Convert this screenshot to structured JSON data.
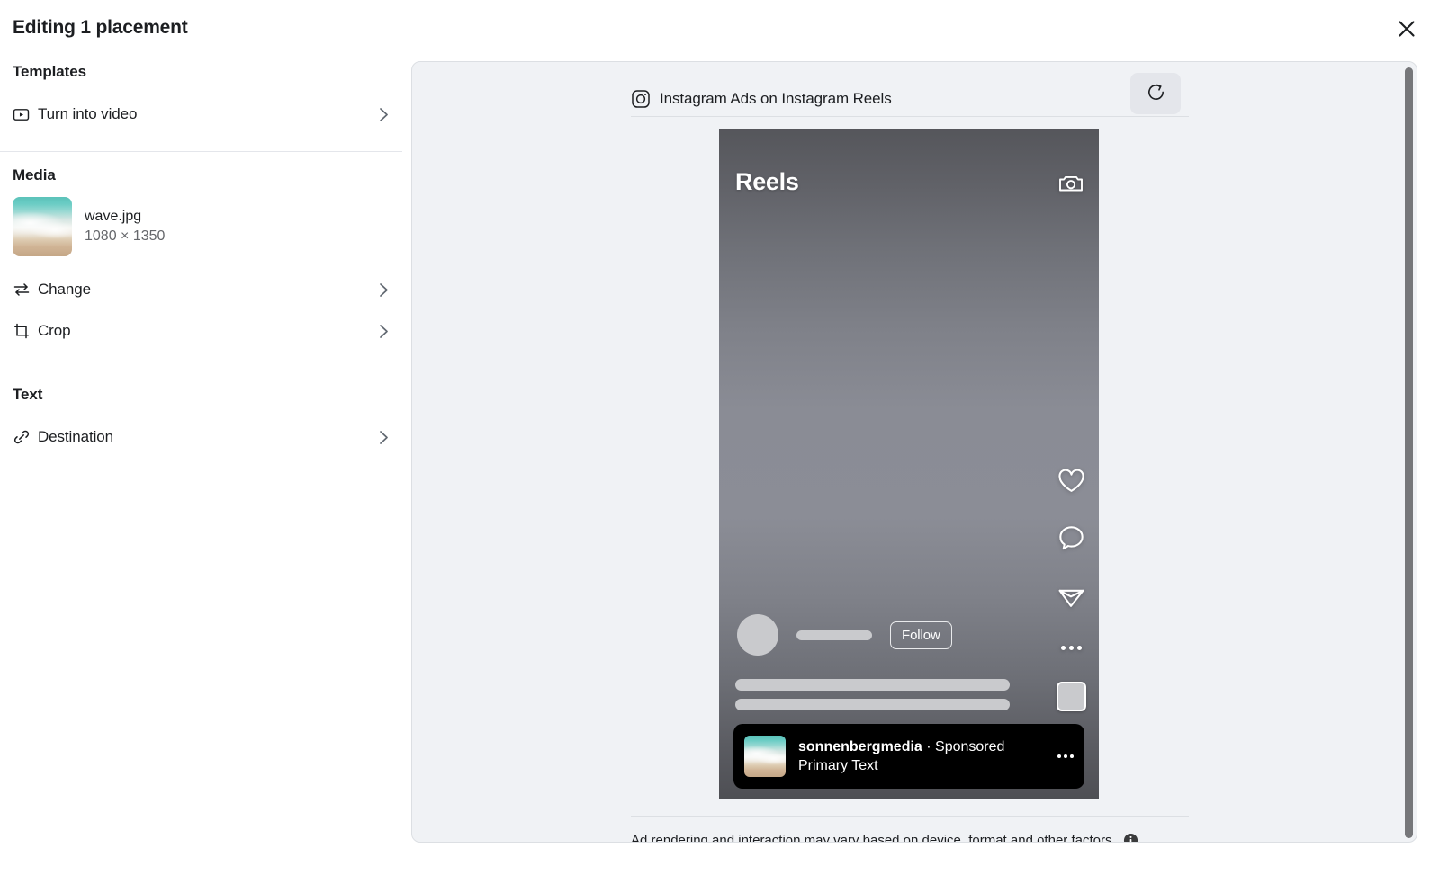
{
  "header": {
    "title": "Editing 1 placement",
    "close_icon": "close-icon"
  },
  "sidebar": {
    "sections": [
      {
        "title": "Templates",
        "rows": [
          {
            "label": "Turn into video",
            "icon": "video-play-icon",
            "chevron": "chevron-right-icon"
          }
        ]
      },
      {
        "title": "Media",
        "media": {
          "file_name": "wave.jpg",
          "dimensions": "1080 × 1350",
          "thumbnail_icon": "wave-image-thumbnail"
        },
        "rows": [
          {
            "label": "Change",
            "icon": "swap-arrows-icon",
            "chevron": "chevron-right-icon"
          },
          {
            "label": "Crop",
            "icon": "crop-icon",
            "chevron": "chevron-right-icon"
          }
        ]
      },
      {
        "title": "Text",
        "rows": [
          {
            "label": "Destination",
            "icon": "link-chain-icon",
            "chevron": "chevron-right-icon"
          }
        ]
      }
    ]
  },
  "preview": {
    "placement_label": "Instagram Ads on Instagram Reels",
    "platform_icon": "instagram-icon",
    "refresh_icon": "refresh-icon",
    "footer_note": "Ad rendering and interaction may vary based on device, format and other factors.",
    "info_icon": "info-icon",
    "mock": {
      "screen_title": "Reels",
      "camera_icon": "camera-icon",
      "follow_label": "Follow",
      "actions": [
        {
          "name": "like-icon"
        },
        {
          "name": "comment-icon"
        },
        {
          "name": "share-icon"
        },
        {
          "name": "more-options-icon"
        }
      ],
      "audio_thumb_icon": "audio-album-thumbnail",
      "sponsor": {
        "account_name": "sonnenbergmedia",
        "separator": " · ",
        "sponsored_label": "Sponsored",
        "primary_text": "Primary Text",
        "menu_icon": "more-options-icon"
      }
    }
  },
  "colors": {
    "panel_bg": "#f0f2f5",
    "text_primary": "#1c1e21",
    "text_secondary": "#65676b",
    "divider": "#e4e6eb",
    "scrollbar": "#76777a",
    "sponsor_card_bg": "#000000"
  }
}
